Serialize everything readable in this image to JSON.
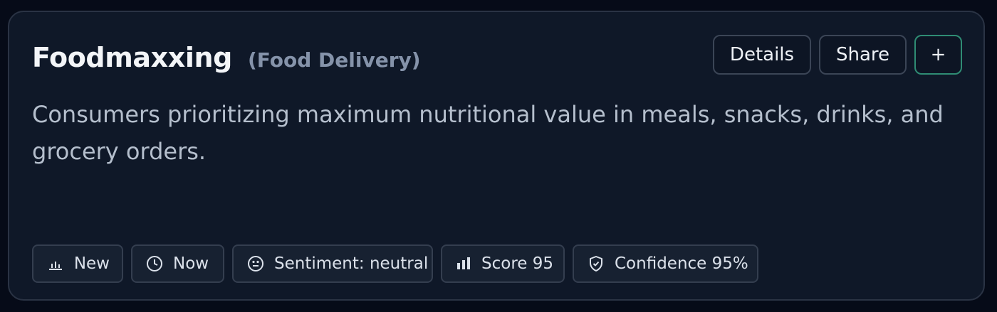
{
  "card": {
    "title": "Foodmaxxing",
    "category": "(Food Delivery)",
    "description": "Consumers prioritizing maximum nutritional value in meals, snacks, drinks, and grocery orders.",
    "actions": {
      "details_label": "Details",
      "share_label": "Share",
      "add_label": "+"
    },
    "tags": [
      {
        "label": "New",
        "icon": "bar-chart-icon"
      },
      {
        "label": "Now",
        "icon": "clock-icon"
      },
      {
        "label": "Sentiment: neutral",
        "icon": "neutral-face-icon"
      },
      {
        "label": "Score 95",
        "icon": "score-bars-icon"
      },
      {
        "label": "Confidence 95%",
        "icon": "shield-check-icon"
      }
    ]
  },
  "colors": {
    "background": "#060b18",
    "card": "#0f1828",
    "accent_border": "#2f8c74",
    "muted_text": "#8593aa"
  }
}
